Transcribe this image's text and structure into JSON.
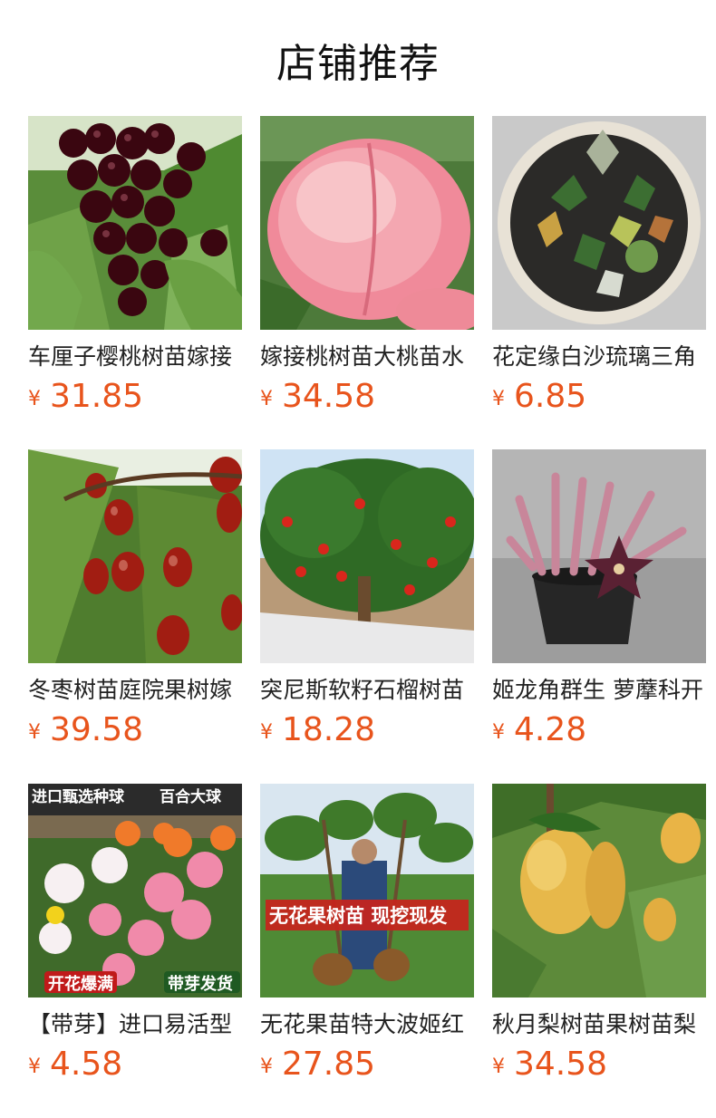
{
  "section_title": "店铺推荐",
  "products": [
    {
      "name": "车厘子樱桃树苗嫁接",
      "currency": "¥",
      "price": "31.85",
      "icon": "cherry-image"
    },
    {
      "name": "嫁接桃树苗大桃苗水",
      "currency": "¥",
      "price": "34.58",
      "icon": "peach-image"
    },
    {
      "name": "花定缘白沙琉璃三角",
      "currency": "¥",
      "price": "6.85",
      "icon": "succulent-pot-image"
    },
    {
      "name": "冬枣树苗庭院果树嫁",
      "currency": "¥",
      "price": "39.58",
      "icon": "jujube-image"
    },
    {
      "name": "突尼斯软籽石榴树苗",
      "currency": "¥",
      "price": "18.28",
      "icon": "pomegranate-tree-image"
    },
    {
      "name": "姬龙角群生 萝藦科开",
      "currency": "¥",
      "price": "4.28",
      "icon": "stapelia-pot-image"
    },
    {
      "name": "【带芽】进口易活型",
      "currency": "¥",
      "price": "4.58",
      "icon": "lily-flowers-image",
      "overlay": [
        "进口甄选种球",
        "百合大球",
        "开花爆满",
        "带芽发货"
      ]
    },
    {
      "name": "无花果苗特大波姬红",
      "currency": "¥",
      "price": "27.85",
      "icon": "fig-seedling-image",
      "overlay": [
        "无花果树苗 现挖现发"
      ]
    },
    {
      "name": "秋月梨树苗果树苗梨",
      "currency": "¥",
      "price": "34.58",
      "icon": "pear-image"
    }
  ],
  "colors": {
    "price": "#e8541c",
    "title": "#111111",
    "name": "#222222"
  }
}
